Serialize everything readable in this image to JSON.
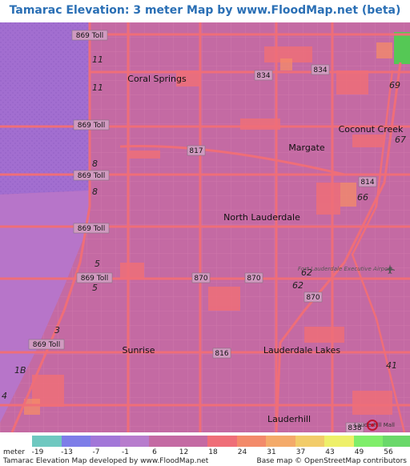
{
  "title": "Tamarac Elevation: 3 meter Map by www.FloodMap.net (beta)",
  "map": {
    "places": {
      "coral_springs": "Coral Springs",
      "margate": "Margate",
      "coconut_creek": "Coconut Creek",
      "north_lauderdale": "North Lauderdale",
      "sunrise": "Sunrise",
      "lauderdale_lakes": "Lauderdale Lakes",
      "lauderhill": "Lauderhill",
      "fort_lauderdale_exec_airport": "Fort Lauderdale Executive Airport"
    },
    "roads": {
      "r869_a": "869 Toll",
      "r869_b": "869 Toll",
      "r869_c": "869 Toll",
      "r869_d": "869 Toll",
      "r869_e": "869 Toll",
      "r869_f": "869 Toll",
      "r834_a": "834",
      "r834_b": "834",
      "r817": "817",
      "r814": "814",
      "r870_a": "870",
      "r870_b": "870",
      "r870_c": "870",
      "r816": "816",
      "r838": "838",
      "n11a": "11",
      "n11b": "11",
      "n8a": "8",
      "n8b": "8",
      "n5a": "5",
      "n5b": "5",
      "n3": "3",
      "n1b": "1B",
      "n69": "69",
      "n67": "67",
      "n66": "66",
      "n62a": "62",
      "n62b": "62",
      "n41": "41",
      "n4": "4"
    },
    "marker_label": "Lauderhill Mall"
  },
  "legend": {
    "unit": "meter",
    "ticks": [
      "-19",
      "-13",
      "-7",
      "-1",
      "6",
      "12",
      "18",
      "24",
      "31",
      "37",
      "43",
      "49",
      "56"
    ],
    "colors": [
      "#6fc8c0",
      "#7d7de8",
      "#a277d8",
      "#b77ccd",
      "#c46aa3",
      "#c46aa3",
      "#ef6e78",
      "#f38a6a",
      "#f4aa6a",
      "#f2cc6a",
      "#eef06a",
      "#7fee6a",
      "#6ad86a"
    ],
    "credit_left": "Tamarac Elevation Map developed by www.FloodMap.net",
    "credit_right": "Base map © OpenStreetMap contributors"
  },
  "colors": {
    "background": "#c46aa3",
    "water": "#a26ed0",
    "high": "#ef6e78",
    "green": "#55c855",
    "title": "#2a6fb5"
  }
}
